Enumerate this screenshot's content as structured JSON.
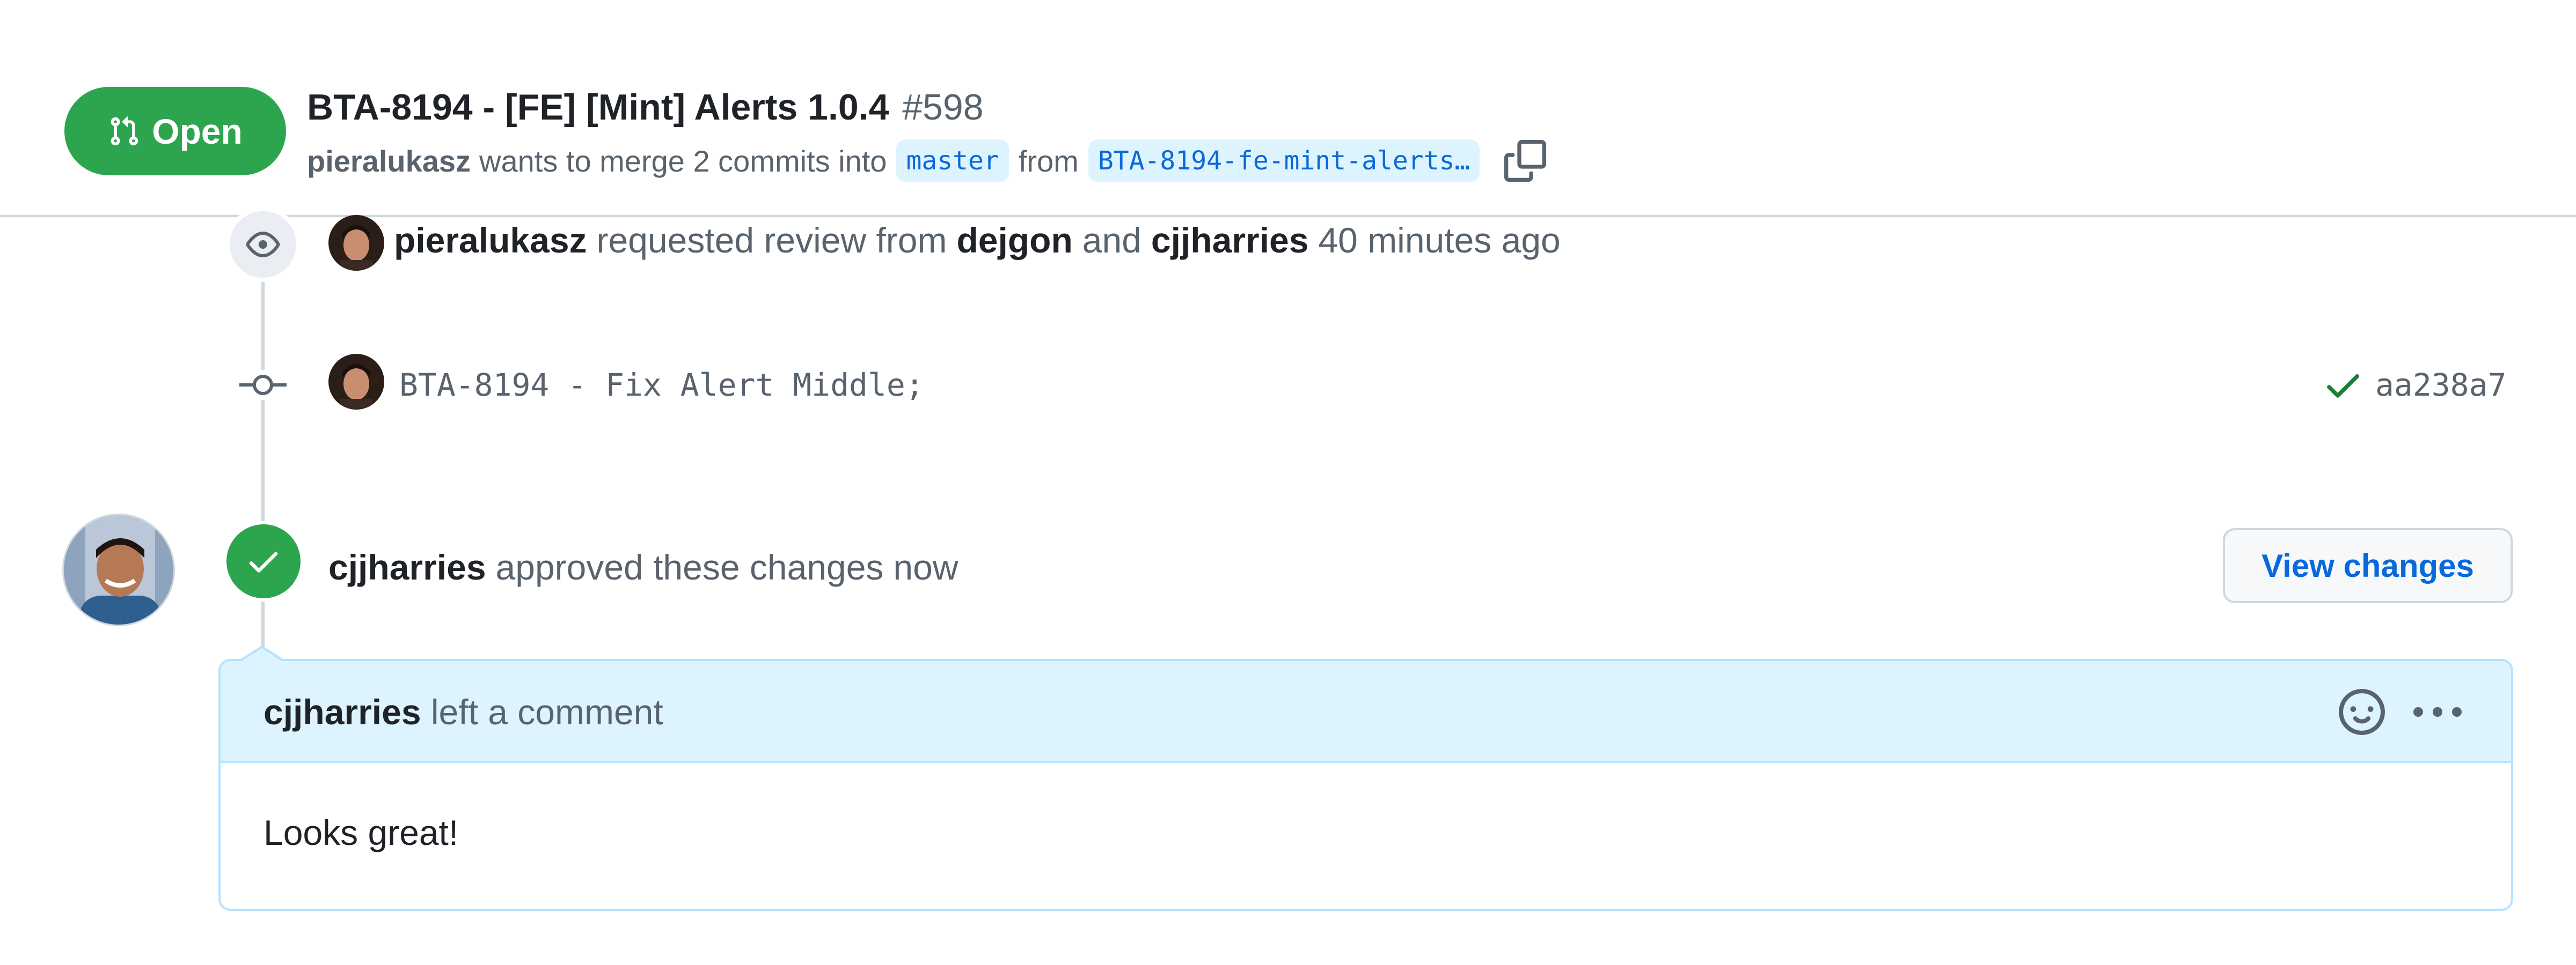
{
  "pull_request": {
    "state_label": "Open",
    "title": "BTA-8194 - [FE] [Mint] Alerts 1.0.4",
    "number": "#598",
    "author": "pieralukasz",
    "meta_text": "wants to merge 2 commits into",
    "base_branch": "master",
    "from_text": "from",
    "head_branch": "BTA-8194-fe-mint-alerts…"
  },
  "timeline": {
    "review_request": {
      "actor": "pieralukasz",
      "action": "requested review from",
      "reviewer_1": "dejgon",
      "and_text": "and",
      "reviewer_2": "cjjharries",
      "time": "40 minutes ago"
    },
    "commit": {
      "message": "BTA-8194 - Fix Alert Middle;",
      "sha": "aa238a7"
    },
    "approval": {
      "actor": "cjjharries",
      "action": "approved these changes",
      "time": "now",
      "view_changes_label": "View changes"
    },
    "comment": {
      "author": "cjjharries",
      "action": "left a comment",
      "body": "Looks great!"
    }
  },
  "colors": {
    "open_green": "#2da44e",
    "link_blue": "#0969da",
    "branch_bg": "#ddf4ff",
    "comment_header_bg": "#ddf4ff",
    "muted_text": "#59636e"
  },
  "icons": {
    "state": "git-pull-request-icon",
    "copy": "copy-icon",
    "review": "eye-icon",
    "commit": "git-commit-icon",
    "check": "check-icon",
    "emoji": "smiley-icon",
    "more": "kebab-horizontal-icon"
  }
}
